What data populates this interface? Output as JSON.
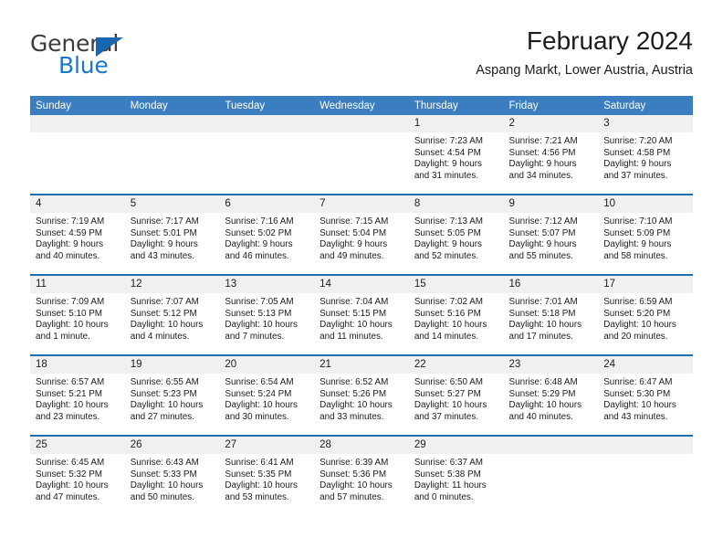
{
  "brand": {
    "name_top": "General",
    "name_bottom": "Blue",
    "accent_color": "#1878c8",
    "triangle_color": "#1667b0"
  },
  "header": {
    "title": "February 2024",
    "subtitle": "Aspang Markt, Lower Austria, Austria"
  },
  "theme": {
    "header_row_bg": "#3a7dc0",
    "row_border": "#1f6cb0",
    "daynum_bg": "#f0f0f0",
    "text": "#1c1c1c"
  },
  "weekdays": [
    "Sunday",
    "Monday",
    "Tuesday",
    "Wednesday",
    "Thursday",
    "Friday",
    "Saturday"
  ],
  "labels": {
    "sunrise_prefix": "Sunrise: ",
    "sunset_prefix": "Sunset: ",
    "daylight_prefix": "Daylight: "
  },
  "weeks": [
    [
      {
        "day": "",
        "empty": true
      },
      {
        "day": "",
        "empty": true
      },
      {
        "day": "",
        "empty": true
      },
      {
        "day": "",
        "empty": true
      },
      {
        "day": "1",
        "sunrise": "Sunrise: 7:23 AM",
        "sunset": "Sunset: 4:54 PM",
        "daylight1": "Daylight: 9 hours",
        "daylight2": "and 31 minutes."
      },
      {
        "day": "2",
        "sunrise": "Sunrise: 7:21 AM",
        "sunset": "Sunset: 4:56 PM",
        "daylight1": "Daylight: 9 hours",
        "daylight2": "and 34 minutes."
      },
      {
        "day": "3",
        "sunrise": "Sunrise: 7:20 AM",
        "sunset": "Sunset: 4:58 PM",
        "daylight1": "Daylight: 9 hours",
        "daylight2": "and 37 minutes."
      }
    ],
    [
      {
        "day": "4",
        "sunrise": "Sunrise: 7:19 AM",
        "sunset": "Sunset: 4:59 PM",
        "daylight1": "Daylight: 9 hours",
        "daylight2": "and 40 minutes."
      },
      {
        "day": "5",
        "sunrise": "Sunrise: 7:17 AM",
        "sunset": "Sunset: 5:01 PM",
        "daylight1": "Daylight: 9 hours",
        "daylight2": "and 43 minutes."
      },
      {
        "day": "6",
        "sunrise": "Sunrise: 7:16 AM",
        "sunset": "Sunset: 5:02 PM",
        "daylight1": "Daylight: 9 hours",
        "daylight2": "and 46 minutes."
      },
      {
        "day": "7",
        "sunrise": "Sunrise: 7:15 AM",
        "sunset": "Sunset: 5:04 PM",
        "daylight1": "Daylight: 9 hours",
        "daylight2": "and 49 minutes."
      },
      {
        "day": "8",
        "sunrise": "Sunrise: 7:13 AM",
        "sunset": "Sunset: 5:05 PM",
        "daylight1": "Daylight: 9 hours",
        "daylight2": "and 52 minutes."
      },
      {
        "day": "9",
        "sunrise": "Sunrise: 7:12 AM",
        "sunset": "Sunset: 5:07 PM",
        "daylight1": "Daylight: 9 hours",
        "daylight2": "and 55 minutes."
      },
      {
        "day": "10",
        "sunrise": "Sunrise: 7:10 AM",
        "sunset": "Sunset: 5:09 PM",
        "daylight1": "Daylight: 9 hours",
        "daylight2": "and 58 minutes."
      }
    ],
    [
      {
        "day": "11",
        "sunrise": "Sunrise: 7:09 AM",
        "sunset": "Sunset: 5:10 PM",
        "daylight1": "Daylight: 10 hours",
        "daylight2": "and 1 minute."
      },
      {
        "day": "12",
        "sunrise": "Sunrise: 7:07 AM",
        "sunset": "Sunset: 5:12 PM",
        "daylight1": "Daylight: 10 hours",
        "daylight2": "and 4 minutes."
      },
      {
        "day": "13",
        "sunrise": "Sunrise: 7:05 AM",
        "sunset": "Sunset: 5:13 PM",
        "daylight1": "Daylight: 10 hours",
        "daylight2": "and 7 minutes."
      },
      {
        "day": "14",
        "sunrise": "Sunrise: 7:04 AM",
        "sunset": "Sunset: 5:15 PM",
        "daylight1": "Daylight: 10 hours",
        "daylight2": "and 11 minutes."
      },
      {
        "day": "15",
        "sunrise": "Sunrise: 7:02 AM",
        "sunset": "Sunset: 5:16 PM",
        "daylight1": "Daylight: 10 hours",
        "daylight2": "and 14 minutes."
      },
      {
        "day": "16",
        "sunrise": "Sunrise: 7:01 AM",
        "sunset": "Sunset: 5:18 PM",
        "daylight1": "Daylight: 10 hours",
        "daylight2": "and 17 minutes."
      },
      {
        "day": "17",
        "sunrise": "Sunrise: 6:59 AM",
        "sunset": "Sunset: 5:20 PM",
        "daylight1": "Daylight: 10 hours",
        "daylight2": "and 20 minutes."
      }
    ],
    [
      {
        "day": "18",
        "sunrise": "Sunrise: 6:57 AM",
        "sunset": "Sunset: 5:21 PM",
        "daylight1": "Daylight: 10 hours",
        "daylight2": "and 23 minutes."
      },
      {
        "day": "19",
        "sunrise": "Sunrise: 6:55 AM",
        "sunset": "Sunset: 5:23 PM",
        "daylight1": "Daylight: 10 hours",
        "daylight2": "and 27 minutes."
      },
      {
        "day": "20",
        "sunrise": "Sunrise: 6:54 AM",
        "sunset": "Sunset: 5:24 PM",
        "daylight1": "Daylight: 10 hours",
        "daylight2": "and 30 minutes."
      },
      {
        "day": "21",
        "sunrise": "Sunrise: 6:52 AM",
        "sunset": "Sunset: 5:26 PM",
        "daylight1": "Daylight: 10 hours",
        "daylight2": "and 33 minutes."
      },
      {
        "day": "22",
        "sunrise": "Sunrise: 6:50 AM",
        "sunset": "Sunset: 5:27 PM",
        "daylight1": "Daylight: 10 hours",
        "daylight2": "and 37 minutes."
      },
      {
        "day": "23",
        "sunrise": "Sunrise: 6:48 AM",
        "sunset": "Sunset: 5:29 PM",
        "daylight1": "Daylight: 10 hours",
        "daylight2": "and 40 minutes."
      },
      {
        "day": "24",
        "sunrise": "Sunrise: 6:47 AM",
        "sunset": "Sunset: 5:30 PM",
        "daylight1": "Daylight: 10 hours",
        "daylight2": "and 43 minutes."
      }
    ],
    [
      {
        "day": "25",
        "sunrise": "Sunrise: 6:45 AM",
        "sunset": "Sunset: 5:32 PM",
        "daylight1": "Daylight: 10 hours",
        "daylight2": "and 47 minutes."
      },
      {
        "day": "26",
        "sunrise": "Sunrise: 6:43 AM",
        "sunset": "Sunset: 5:33 PM",
        "daylight1": "Daylight: 10 hours",
        "daylight2": "and 50 minutes."
      },
      {
        "day": "27",
        "sunrise": "Sunrise: 6:41 AM",
        "sunset": "Sunset: 5:35 PM",
        "daylight1": "Daylight: 10 hours",
        "daylight2": "and 53 minutes."
      },
      {
        "day": "28",
        "sunrise": "Sunrise: 6:39 AM",
        "sunset": "Sunset: 5:36 PM",
        "daylight1": "Daylight: 10 hours",
        "daylight2": "and 57 minutes."
      },
      {
        "day": "29",
        "sunrise": "Sunrise: 6:37 AM",
        "sunset": "Sunset: 5:38 PM",
        "daylight1": "Daylight: 11 hours",
        "daylight2": "and 0 minutes."
      },
      {
        "day": "",
        "empty": true
      },
      {
        "day": "",
        "empty": true
      }
    ]
  ]
}
